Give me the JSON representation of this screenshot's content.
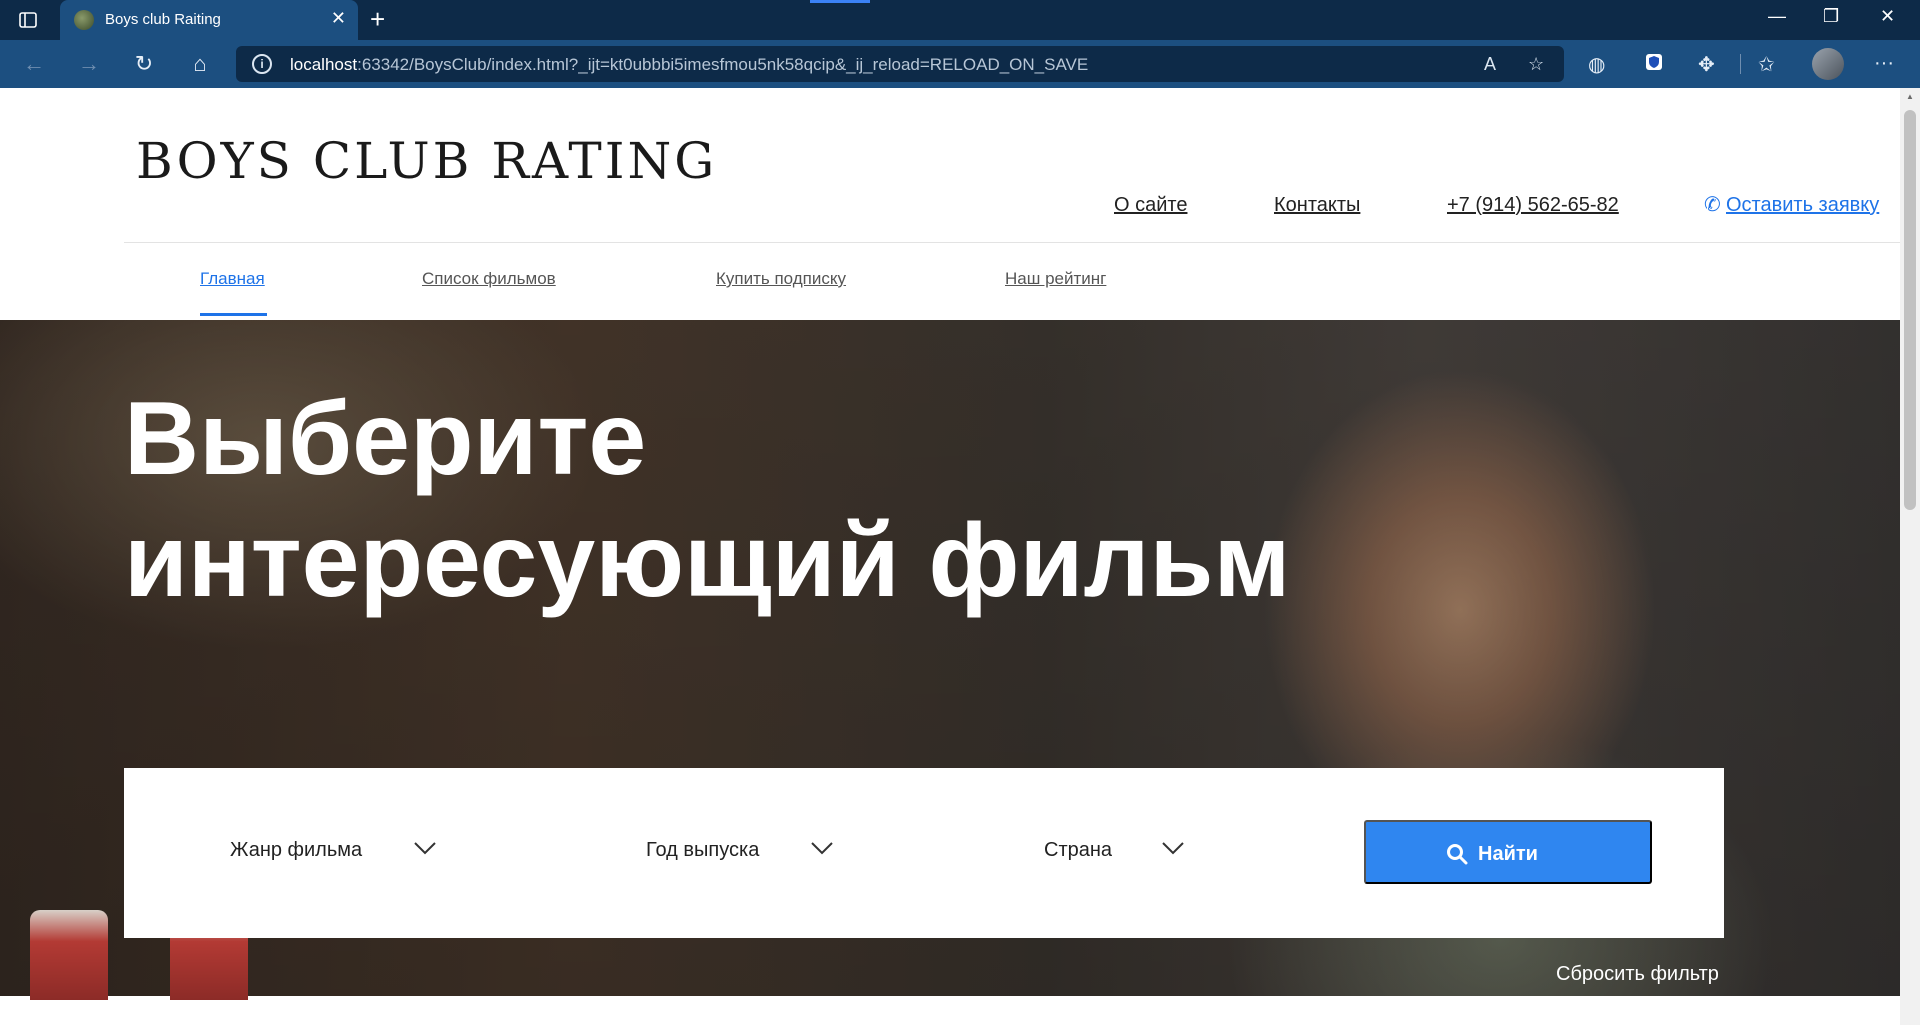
{
  "browser": {
    "tab_title": "Boys club Raiting",
    "url_host": "localhost",
    "url_rest": ":63342/BoysClub/index.html?_ijt=kt0ubbbi5imesfmou5nk58qcip&_ij_reload=RELOAD_ON_SAVE",
    "icons": {
      "tab_actions": "tab-actions-icon",
      "close_tab": "close-icon",
      "new_tab": "plus-icon",
      "back": "back-arrow-icon",
      "forward": "forward-arrow-icon",
      "refresh": "refresh-icon",
      "home": "home-icon",
      "site_info": "info-icon",
      "read_aloud": "read-aloud-icon",
      "add_favorite": "add-favorite-icon",
      "browser_essentials": "globe-icon",
      "extension": "shield-extension-icon",
      "extensions": "puzzle-icon",
      "favorites": "favorites-icon",
      "profile": "avatar",
      "menu": "more-icon"
    }
  },
  "site": {
    "logo": "BOYS CLUB RATING",
    "top_links": {
      "about": "О сайте",
      "contacts": "Контакты",
      "phone": "+7 (914) 562-65-82",
      "cta": "Оставить заявку"
    },
    "menu": [
      {
        "label": "Главная",
        "active": true
      },
      {
        "label": "Список фильмов",
        "active": false
      },
      {
        "label": "Купить подписку",
        "active": false
      },
      {
        "label": "Наш рейтинг",
        "active": false
      }
    ],
    "hero": {
      "title_line1": "Выберите",
      "title_line2": "интересующий фильм"
    },
    "filters": {
      "genre": "Жанр фильма",
      "year": "Год выпуска",
      "country": "Страна",
      "search_button": "Найти",
      "reset": "Сбросить фильтр"
    }
  },
  "colors": {
    "accent": "#1e73e8",
    "button": "#2f86f0",
    "browser_frame": "#0d2a48",
    "browser_toolbar": "#1c4f80"
  }
}
